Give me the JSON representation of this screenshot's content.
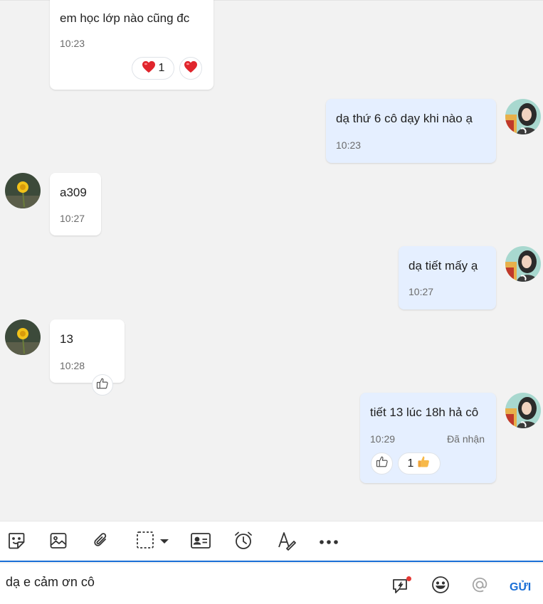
{
  "colors": {
    "accent": "#1a6fd6",
    "outgoing_bubble": "#e5efff",
    "incoming_bubble": "#ffffff",
    "heart": "#e0252c",
    "notification_dot": "#e53935"
  },
  "messages": [
    {
      "direction": "incoming",
      "text": "em học lớp nào cũng đc",
      "time": "10:23",
      "reactions": [
        {
          "icon": "heart-icon",
          "count": "1"
        }
      ],
      "quick_react": "heart-icon"
    },
    {
      "direction": "outgoing",
      "text": "dạ thứ 6 cô dạy khi nào ạ",
      "time": "10:23"
    },
    {
      "direction": "incoming",
      "text": "a309",
      "time": "10:27"
    },
    {
      "direction": "outgoing",
      "text": "dạ tiết mấy ạ",
      "time": "10:27"
    },
    {
      "direction": "incoming",
      "text": "13",
      "time": "10:28",
      "quick_react": "thumbs-up-outline-icon"
    },
    {
      "direction": "outgoing",
      "text": "tiết 13 lúc 18h hả cô",
      "time": "10:29",
      "status": "Đã nhận",
      "quick_react": "thumbs-up-outline-icon",
      "reactions": [
        {
          "icon": "thumbs-up-icon",
          "count": "1"
        }
      ]
    }
  ],
  "toolbar": {
    "tools": [
      "sticker-icon",
      "image-icon",
      "attachment-icon",
      "screenshot-icon",
      "dropdown-caret-icon",
      "contact-card-icon",
      "reminder-clock-icon",
      "text-format-icon",
      "more-icon"
    ]
  },
  "composer": {
    "value": "dạ e cảm ơn cô",
    "icons": [
      "quick-message-icon",
      "emoji-icon",
      "mention-icon"
    ],
    "send_label": "GỬI"
  }
}
